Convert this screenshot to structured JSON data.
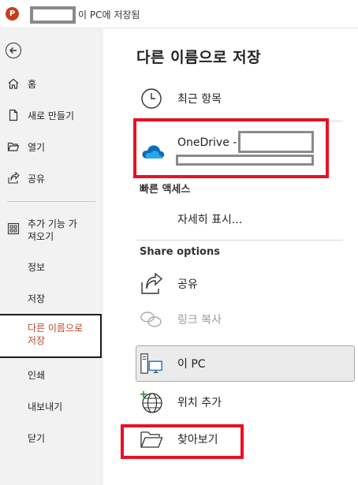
{
  "titlebar": {
    "app_icon": "powerpoint-icon",
    "save_status": "이 PC에 저장됨"
  },
  "sidebar": {
    "back_icon": "back-arrow-icon",
    "items": [
      {
        "label": "홈",
        "icon": "home-icon"
      },
      {
        "label": "새로 만들기",
        "icon": "new-file-icon"
      },
      {
        "label": "열기",
        "icon": "folder-open-icon"
      },
      {
        "label": "공유",
        "icon": "share-icon"
      },
      {
        "label": "추가 기능 가\n져오기",
        "icon": "add-ins-icon"
      },
      {
        "label": "정보"
      },
      {
        "label": "저장"
      },
      {
        "label": "다른 이름으로\n저장"
      },
      {
        "label": "인쇄"
      },
      {
        "label": "내보내기"
      },
      {
        "label": "닫기"
      }
    ]
  },
  "main": {
    "title": "다른 이름으로 저장",
    "recent": {
      "label": "최근 항목",
      "icon": "clock-icon"
    },
    "onedrive": {
      "label": "OneDrive -",
      "icon": "cloud-icon"
    },
    "quick_access": {
      "heading": "빠른 액세스",
      "more": "자세히 표시..."
    },
    "share_options": {
      "heading": "Share options",
      "share": {
        "label": "공유",
        "icon": "share-icon"
      },
      "copy_link": {
        "label": "링크 복사",
        "icon": "link-icon"
      }
    },
    "this_pc": {
      "label": "이 PC",
      "icon": "pc-icon"
    },
    "add_place": {
      "label": "위치 추가",
      "icon": "globe-plus-icon"
    },
    "browse": {
      "label": "찾아보기",
      "icon": "folder-icon"
    }
  },
  "colors": {
    "highlight_red": "#e81123",
    "active_text": "#b7472a",
    "powerpoint": "#c43e1c",
    "onedrive_blue": "#0f6cbd"
  }
}
